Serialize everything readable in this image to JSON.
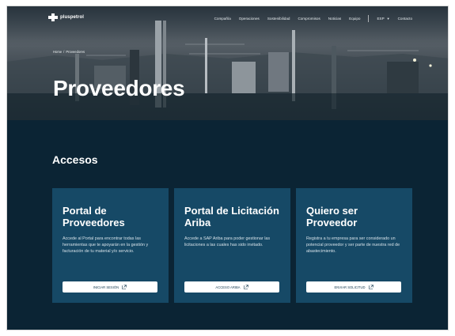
{
  "header": {
    "logo_text": "pluspetrol",
    "nav": [
      "Compañía",
      "Operaciones",
      "Sostenibilidad",
      "Compromisos",
      "Noticias",
      "Equipo"
    ],
    "language": "ESP",
    "contact": "Contacto"
  },
  "hero": {
    "breadcrumb": [
      "Home",
      "/",
      "Proveedores"
    ],
    "title": "Proveedores"
  },
  "section": {
    "title": "Accesos"
  },
  "cards": [
    {
      "title": "Portal de Proveedores",
      "description": "Accede al Portal para encontrar todas las herramientas que te apoyarán en la gestión y facturación de tu material y/o servicio.",
      "button": "INICIAR SESIÓN"
    },
    {
      "title": "Portal de Licitación Ariba",
      "description": "Accede a SAP Ariba para poder gestionar las licitaciones a las cuales has sido invitado.",
      "button": "ACCESO ARIBA"
    },
    {
      "title": "Quiero ser Proveedor",
      "description": "Registra a tu empresa para ser considerado un potencial proveedor y ser parte de nuestra red de abastecimiento.",
      "button": "ENVIAR SOLICITUD"
    }
  ],
  "icons": {
    "logo": "pluspetrol-logo-icon",
    "caret": "chevron-down-icon",
    "external": "external-link-icon"
  },
  "colors": {
    "page_background": "#0b2434",
    "card_background": "#164966",
    "button_background": "#ffffff",
    "button_text": "#12384f"
  }
}
